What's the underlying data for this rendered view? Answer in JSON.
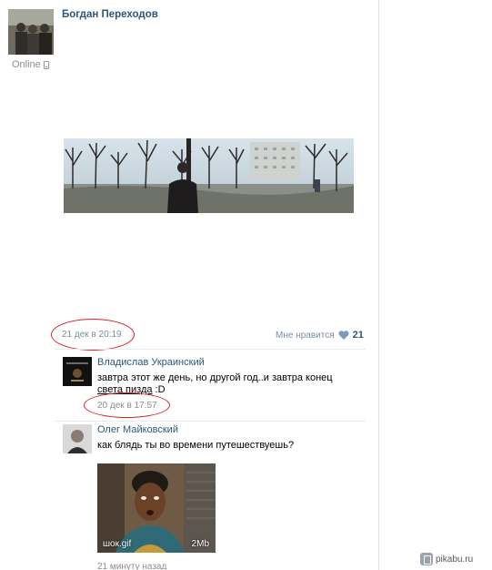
{
  "profile": {
    "name": "Богдан Переходов",
    "status": "Online"
  },
  "post": {
    "date": "21 дек в 20:19",
    "like_label": "Мне нравится",
    "like_count": "21"
  },
  "comments": [
    {
      "author": "Владислав Украинский",
      "text_line1": "завтра этот же день, но другой год..и завтра конец",
      "text_line2_underlined": "света пизда",
      "text_line2_rest": " :D",
      "date": "20 дек в 17:57"
    },
    {
      "author": "Олег Майковский",
      "text": "как блядь ты во времени путешествуешь?",
      "attachment": {
        "filename": "шок.gif",
        "size": "2Mb"
      },
      "date": "21 минуту назад"
    }
  ],
  "watermark": "pikabu.ru",
  "icons": [
    "phone-icon",
    "heart-icon",
    "pikabu-icon"
  ],
  "colors": {
    "link": "#2b587a",
    "meta": "#7b8ea3",
    "annotation": "#d8202a"
  }
}
